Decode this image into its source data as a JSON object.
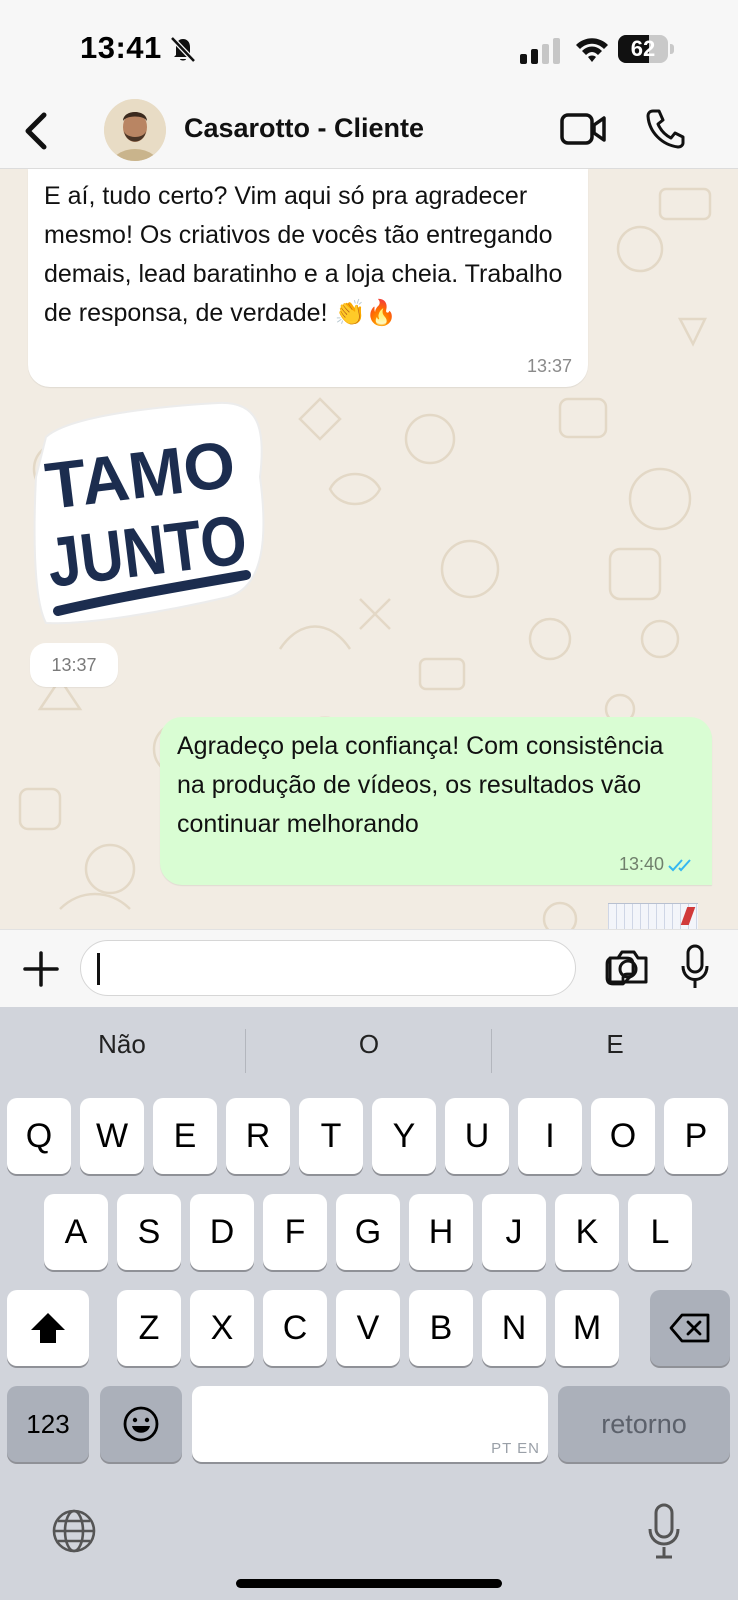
{
  "status_bar": {
    "time": "13:41",
    "battery": "62",
    "battery_level": 0.62,
    "icons": [
      "bell-off-icon",
      "cellular-signal-icon",
      "wifi-icon",
      "battery-icon"
    ]
  },
  "header": {
    "contact_name": "Casarotto - Cliente",
    "icons": [
      "back-chevron-icon",
      "video-call-icon",
      "phone-icon"
    ]
  },
  "messages": [
    {
      "direction": "incoming",
      "text": "E aí, tudo certo? Vim aqui só pra agradecer mesmo! Os criativos de vocês tão entregando demais, lead baratinho e a loja cheia. Trabalho de responsa, de verdade! 👏🔥",
      "time": "13:37"
    },
    {
      "direction": "incoming",
      "type": "sticker",
      "sticker_line1": "TAMO",
      "sticker_line2": "JUNTO",
      "time": "13:37"
    },
    {
      "direction": "outgoing",
      "text": "Agradeço pela confiança! Com consistência na produção de vídeos, os resultados vão continuar melhorando",
      "time": "13:40",
      "status": "read"
    }
  ],
  "input_bar": {
    "value": "",
    "icons": [
      "plus-icon",
      "sticker-icon",
      "camera-icon",
      "microphone-icon"
    ]
  },
  "keyboard": {
    "suggestions": [
      "Não",
      "O",
      "E"
    ],
    "row1": [
      "Q",
      "W",
      "E",
      "R",
      "T",
      "Y",
      "U",
      "I",
      "O",
      "P"
    ],
    "row2": [
      "A",
      "S",
      "D",
      "F",
      "G",
      "H",
      "J",
      "K",
      "L"
    ],
    "row3": [
      "Z",
      "X",
      "C",
      "V",
      "B",
      "N",
      "M"
    ],
    "numbers_key": "123",
    "return_key": "retorno",
    "space_lang": "PT EN",
    "icons": [
      "shift-icon",
      "backspace-icon",
      "emoji-icon",
      "globe-icon",
      "dictation-mic-icon"
    ]
  },
  "colors": {
    "incoming_bubble": "#ffffff",
    "outgoing_bubble": "#d9fdd3",
    "read_ticks": "#34b7f1",
    "chat_background": "#f2ece3",
    "sticker_navy": "#1c2d4f"
  }
}
